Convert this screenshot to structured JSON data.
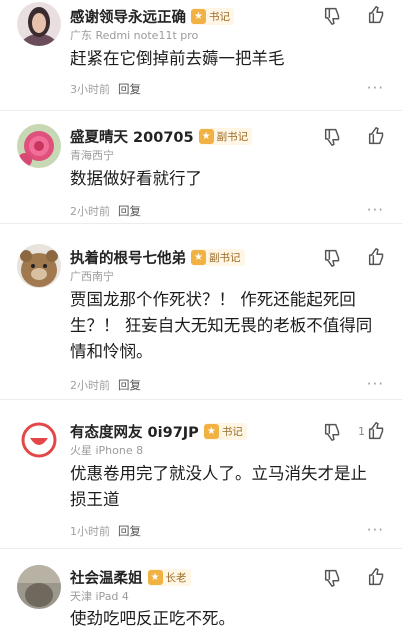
{
  "comments": [
    {
      "username": "感谢领导永远正确",
      "badge": "书记",
      "location": "广东  Redmi note11t pro",
      "text": "赶紧在它倒掉前去薅一把羊毛",
      "time": "3小时前",
      "reply": "回复",
      "likes": ""
    },
    {
      "username": "盛夏晴天 200705",
      "badge": "副书记",
      "location": "青海西宁",
      "text": "数据做好看就行了",
      "time": "2小时前",
      "reply": "回复",
      "likes": ""
    },
    {
      "username": "执着的根号七他弟",
      "badge": "副书记",
      "location": "广西南宁",
      "text": "贾国龙那个作死状？！ 作死还能起死回生？！ 狂妄自大无知无畏的老板不值得同情和怜悯。",
      "time": "2小时前",
      "reply": "回复",
      "likes": ""
    },
    {
      "username": "有态度网友 0i97JP",
      "badge": "书记",
      "location": "火星  iPhone 8",
      "text": "优惠卷用完了就没人了。立马消失才是止损王道",
      "time": "1小时前",
      "reply": "回复",
      "likes": "1"
    },
    {
      "username": "社会温柔姐",
      "badge": "长老",
      "location": "天津  iPad 4",
      "text": "使劲吃吧反正吃不死。",
      "time": "",
      "reply": "",
      "likes": ""
    }
  ],
  "icons": {
    "more": "more-dots-icon",
    "thumb_down": "thumb-down-icon",
    "thumb_up": "thumb-up-icon",
    "badge": "badge-icon"
  },
  "colors": {
    "badge_bg": "#fff6e6",
    "badge_icon": "#f2b143",
    "badge_text": "#9a6b24",
    "secondary_text": "#9b9b9b"
  }
}
